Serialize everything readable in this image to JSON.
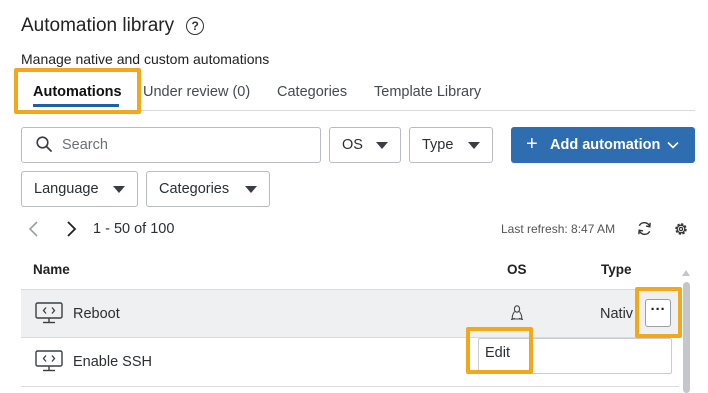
{
  "header": {
    "title": "Automation library",
    "help_icon": "?",
    "subtitle": "Manage native and custom automations"
  },
  "tabs": [
    {
      "label": "Automations",
      "active": true
    },
    {
      "label": "Under review (0)",
      "active": false
    },
    {
      "label": "Categories",
      "active": false
    },
    {
      "label": "Template Library",
      "active": false
    }
  ],
  "filters": {
    "search_placeholder": "Search",
    "os_label": "OS",
    "type_label": "Type",
    "language_label": "Language",
    "categories_label": "Categories"
  },
  "add_button": {
    "plus": "+",
    "label": "Add automation"
  },
  "pagination": {
    "range": "1 - 50 of 100",
    "last_refresh": "Last refresh: 8:47 AM"
  },
  "table": {
    "columns": [
      "Name",
      "OS",
      "Type"
    ],
    "rows": [
      {
        "name": "Reboot",
        "os_icon": "linux-icon",
        "type": "Nativ"
      },
      {
        "name": "Enable SSH",
        "os_icon": "",
        "type": ""
      }
    ]
  },
  "row_actions": {
    "more": "···",
    "menu_items": [
      "Edit"
    ]
  },
  "colors": {
    "accent": "#2f6db1",
    "highlight": "#f2a81d",
    "tab_underline": "#1f5fa8",
    "row_hover": "#eef0f2"
  }
}
